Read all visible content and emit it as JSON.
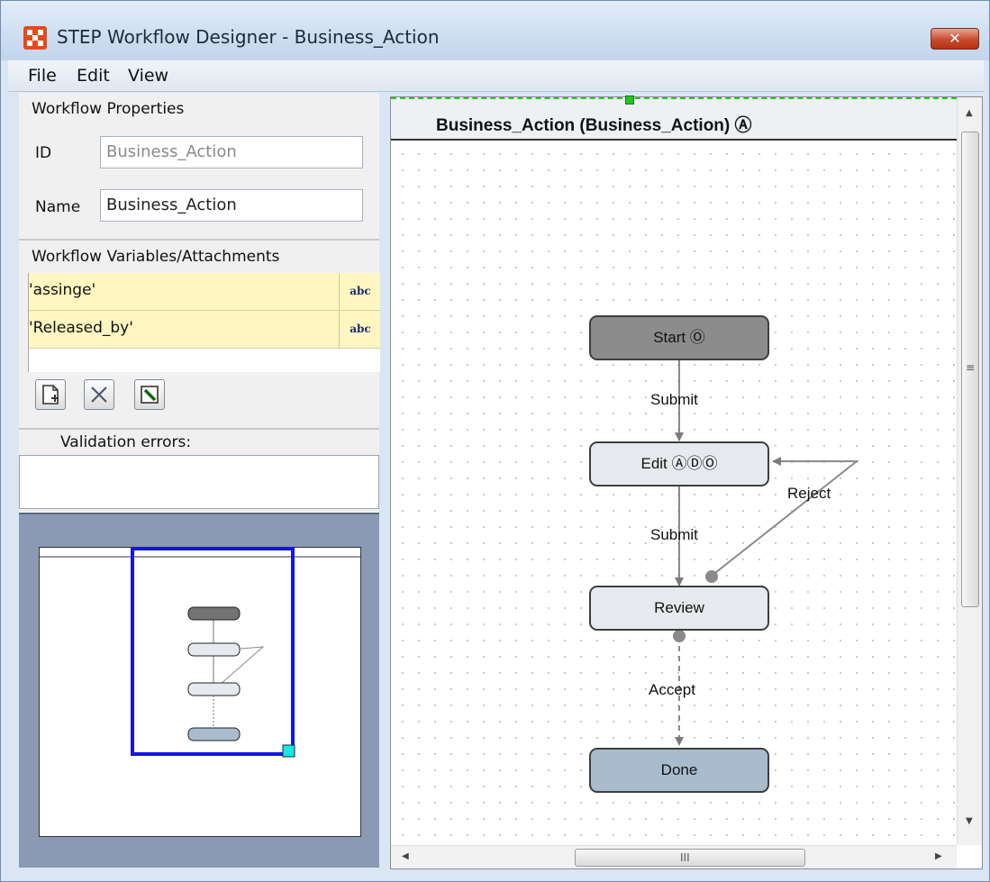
{
  "window": {
    "title": "STEP Workflow Designer - Business_Action",
    "close_glyph": "✕"
  },
  "menu": {
    "items": [
      "File",
      "Edit",
      "View"
    ]
  },
  "properties": {
    "title": "Workflow Properties",
    "id_label": "ID",
    "id_value": "Business_Action",
    "name_label": "Name",
    "name_value": "Business_Action"
  },
  "variables": {
    "title": "Workflow Variables/Attachments",
    "rows": [
      {
        "name": "'assinge'",
        "type": "abc"
      },
      {
        "name": "'Released_by'",
        "type": "abc"
      }
    ]
  },
  "toolbar": {
    "add_icon": "new-document-icon",
    "delete_icon": "delete-x-icon",
    "edit_icon": "edit-pencil-icon"
  },
  "validation": {
    "title": "Validation errors:",
    "text": ""
  },
  "canvas": {
    "title": "Business_Action (Business_Action) Ⓐ",
    "nodes": {
      "start": "Start Ⓞ",
      "edit": "Edit ⒶⒹⓄ",
      "review": "Review",
      "done": "Done"
    },
    "edges": {
      "submit1": "Submit",
      "submit2": "Submit",
      "reject": "Reject",
      "accept": "Accept"
    },
    "scroll_grip_v": "≡",
    "scroll_grip_h": "III"
  },
  "colors": {
    "start_fill": "#8c8c8c",
    "node_fill": "#e6eaef",
    "done_fill": "#a9bccd",
    "viewport_blue": "#1414e6",
    "handle_cyan": "#19e6e6"
  }
}
